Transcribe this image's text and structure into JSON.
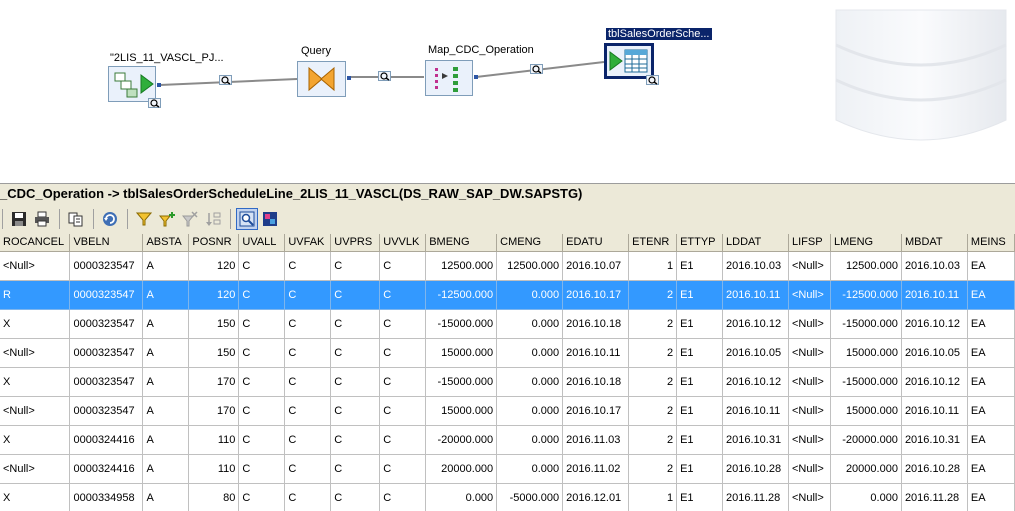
{
  "canvas": {
    "nodes": [
      {
        "label": "\"2LIS_11_VASCL_PJ..."
      },
      {
        "label": "Query"
      },
      {
        "label": "Map_CDC_Operation"
      },
      {
        "label": "tblSalesOrderSche..."
      }
    ]
  },
  "pane": {
    "title": "_CDC_Operation -> tblSalesOrderScheduleLine_2LIS_11_VASCL(DS_RAW_SAP_DW.SAPSTG)"
  },
  "toolbar": {
    "buttons": [
      "save-icon",
      "print-icon",
      "copy-icon",
      "refresh-icon",
      "filter-icon",
      "add-filter-icon",
      "remove-filter-icon",
      "sort-icon",
      "view-data-icon",
      "compare-icon"
    ]
  },
  "grid": {
    "columns": [
      "ROCANCEL",
      "VBELN",
      "ABSTA",
      "POSNR",
      "UVALL",
      "UVFAK",
      "UVPRS",
      "UVVLK",
      "BMENG",
      "CMENG",
      "EDATU",
      "ETENR",
      "ETTYP",
      "LDDAT",
      "LIFSP",
      "LMENG",
      "MBDAT",
      "MEINS"
    ],
    "rows": [
      [
        "<Null>",
        "0000323547",
        "A",
        "120",
        "C",
        "C",
        "C",
        "C",
        "12500.000",
        "12500.000",
        "2016.10.07",
        "1",
        "E1",
        "2016.10.03",
        "<Null>",
        "12500.000",
        "2016.10.03",
        "EA"
      ],
      [
        "R",
        "0000323547",
        "A",
        "120",
        "C",
        "C",
        "C",
        "C",
        "-12500.000",
        "0.000",
        "2016.10.17",
        "2",
        "E1",
        "2016.10.11",
        "<Null>",
        "-12500.000",
        "2016.10.11",
        "EA"
      ],
      [
        "X",
        "0000323547",
        "A",
        "150",
        "C",
        "C",
        "C",
        "C",
        "-15000.000",
        "0.000",
        "2016.10.18",
        "2",
        "E1",
        "2016.10.12",
        "<Null>",
        "-15000.000",
        "2016.10.12",
        "EA"
      ],
      [
        "<Null>",
        "0000323547",
        "A",
        "150",
        "C",
        "C",
        "C",
        "C",
        "15000.000",
        "0.000",
        "2016.10.11",
        "2",
        "E1",
        "2016.10.05",
        "<Null>",
        "15000.000",
        "2016.10.05",
        "EA"
      ],
      [
        "X",
        "0000323547",
        "A",
        "170",
        "C",
        "C",
        "C",
        "C",
        "-15000.000",
        "0.000",
        "2016.10.18",
        "2",
        "E1",
        "2016.10.12",
        "<Null>",
        "-15000.000",
        "2016.10.12",
        "EA"
      ],
      [
        "<Null>",
        "0000323547",
        "A",
        "170",
        "C",
        "C",
        "C",
        "C",
        "15000.000",
        "0.000",
        "2016.10.17",
        "2",
        "E1",
        "2016.10.11",
        "<Null>",
        "15000.000",
        "2016.10.11",
        "EA"
      ],
      [
        "X",
        "0000324416",
        "A",
        "110",
        "C",
        "C",
        "C",
        "C",
        "-20000.000",
        "0.000",
        "2016.11.03",
        "2",
        "E1",
        "2016.10.31",
        "<Null>",
        "-20000.000",
        "2016.10.31",
        "EA"
      ],
      [
        "<Null>",
        "0000324416",
        "A",
        "110",
        "C",
        "C",
        "C",
        "C",
        "20000.000",
        "0.000",
        "2016.11.02",
        "2",
        "E1",
        "2016.10.28",
        "<Null>",
        "20000.000",
        "2016.10.28",
        "EA"
      ],
      [
        "X",
        "0000334958",
        "A",
        "80",
        "C",
        "C",
        "C",
        "C",
        "0.000",
        "-5000.000",
        "2016.12.01",
        "1",
        "E1",
        "2016.11.28",
        "<Null>",
        "0.000",
        "2016.11.28",
        "EA"
      ]
    ],
    "selected_row": 1
  }
}
